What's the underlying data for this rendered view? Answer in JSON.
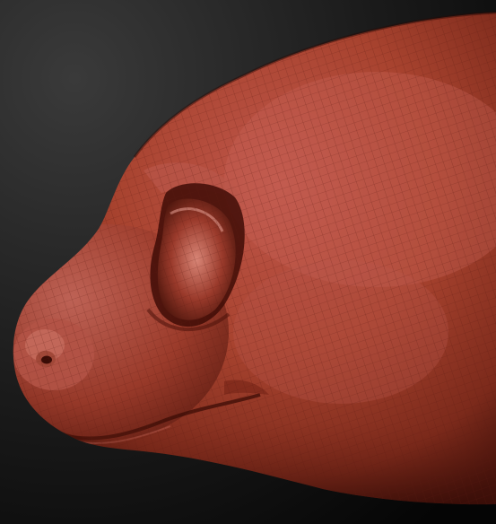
{
  "scene": {
    "subject": "sculpted-creature-snout",
    "colors": {
      "bg_top": "#3a3a3a",
      "bg_bottom": "#050505",
      "clay_light": "#c0574b",
      "clay_mid": "#8f3325",
      "clay_dark": "#3b0e08",
      "wire": "#5a1a12"
    }
  }
}
